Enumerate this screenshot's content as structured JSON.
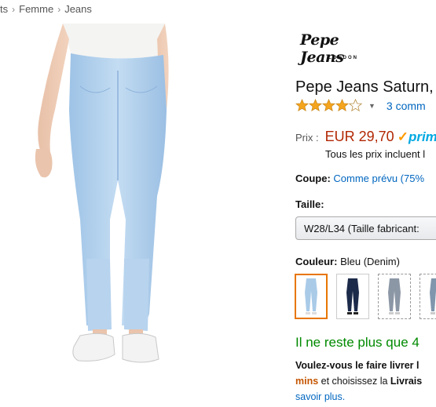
{
  "breadcrumb": {
    "items": [
      "ts",
      "Femme",
      "Jeans"
    ],
    "separator": "›"
  },
  "brand": {
    "logo_text": "Pepe Jeans",
    "logo_sub": "LONDON"
  },
  "product": {
    "title": "Pepe Jeans Saturn,",
    "rating": 4,
    "rating_max": 5,
    "reviews_label": "3 comm",
    "price_label": "Prix :",
    "price": "EUR 29,70",
    "prime_check": "✓",
    "prime_word": "prim",
    "tax_note": "Tous les prix incluent l"
  },
  "fit": {
    "label": "Coupe:",
    "value": "Comme prévu (75%"
  },
  "size": {
    "label": "Taille:",
    "selected": "W28/L34 (Taille fabricant:"
  },
  "color": {
    "label": "Couleur:",
    "value": "Bleu (Denim)",
    "swatches": [
      {
        "name": "light-blue",
        "hex": "#a9cbe8",
        "selected": true
      },
      {
        "name": "dark-navy",
        "hex": "#1c2a4a",
        "selected": false
      },
      {
        "name": "grey-denim",
        "hex": "#8c97a6",
        "selected": false
      },
      {
        "name": "blue-grey",
        "hex": "#7f96ad",
        "selected": false
      }
    ]
  },
  "stock": {
    "text": "Il ne reste plus que 4"
  },
  "delivery": {
    "line1": "Voulez-vous le faire livrer l",
    "mins": "mins",
    "line2": " et choisissez la ",
    "livrais": "Livrais",
    "more_link": "savoir plus."
  },
  "colors": {
    "link": "#0066c0",
    "price": "#b12704",
    "stock": "#008a00",
    "selected_border": "#e77600",
    "star": "#f4a41d"
  }
}
